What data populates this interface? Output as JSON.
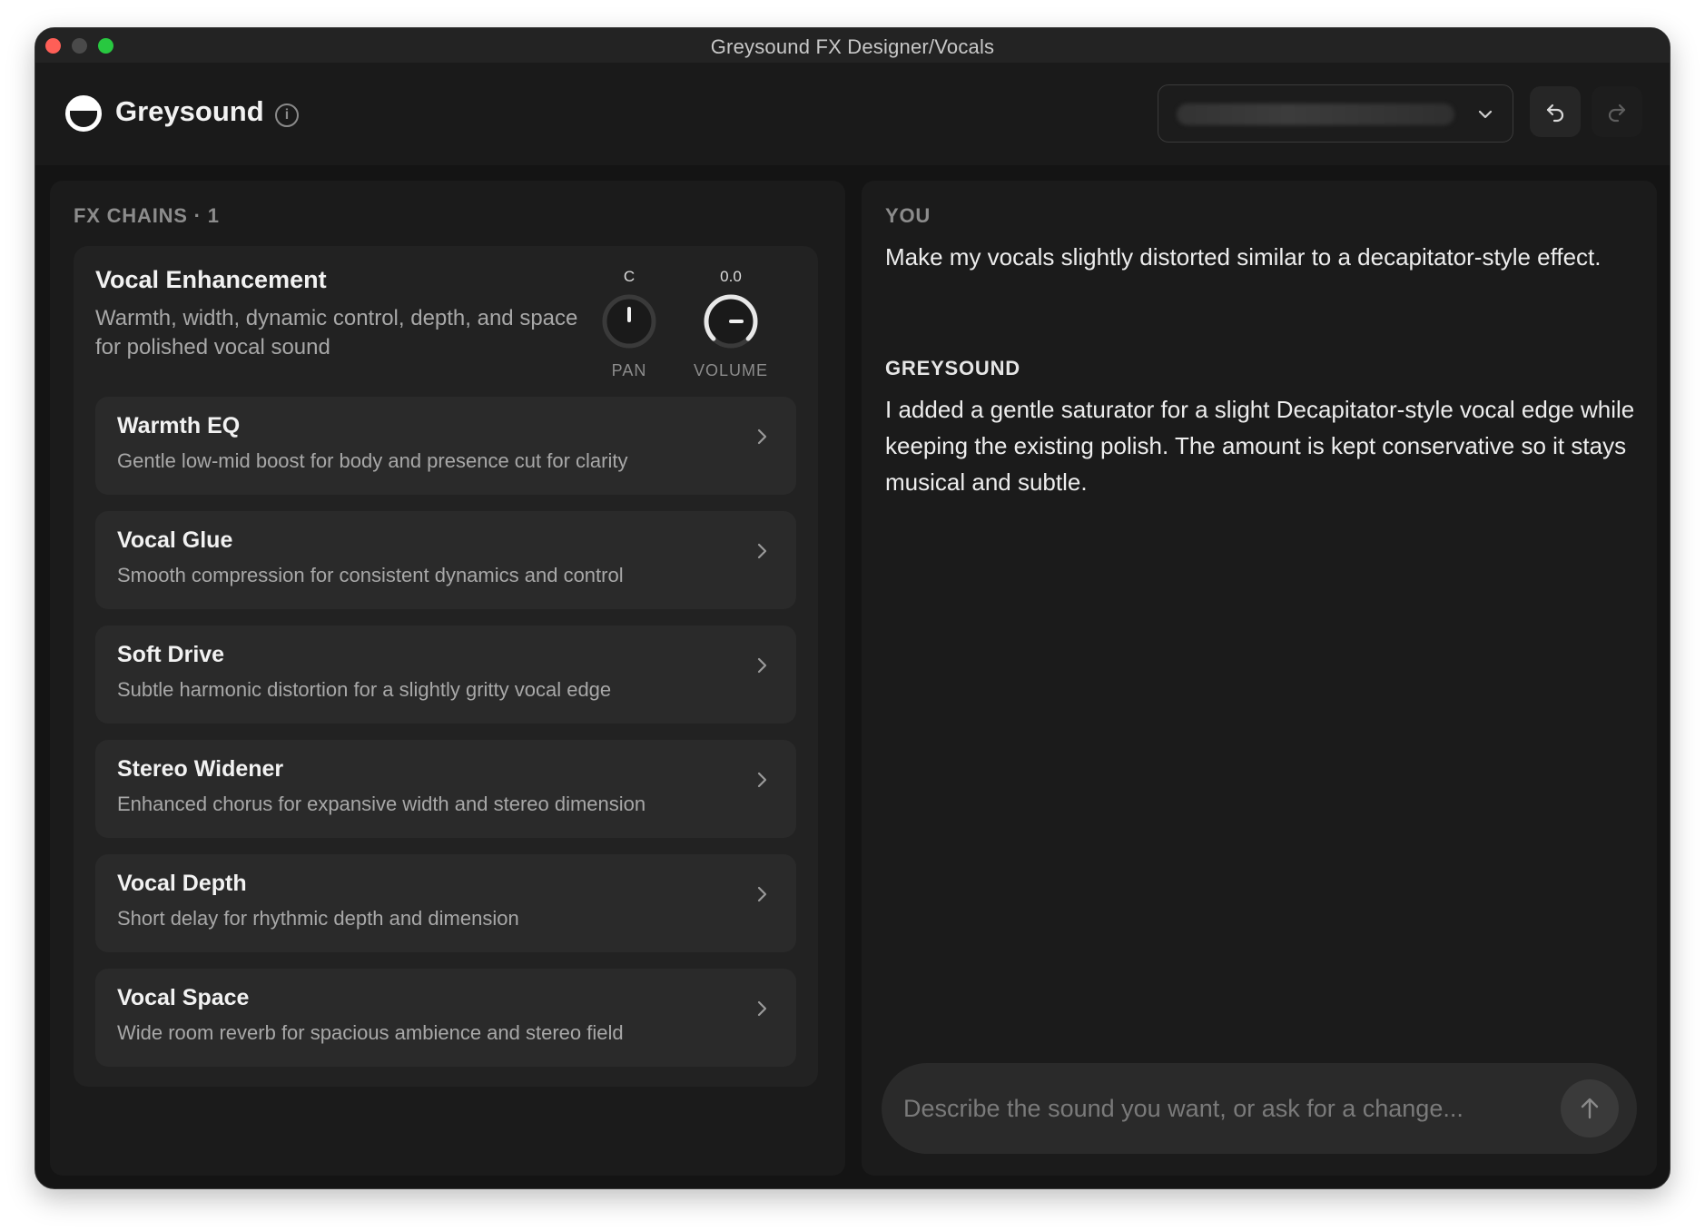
{
  "window": {
    "title": "Greysound FX Designer/Vocals"
  },
  "header": {
    "brand": "Greysound",
    "icons": {
      "logo": "greysound-logo",
      "info": "info-icon",
      "undo": "undo-icon",
      "redo": "redo-icon",
      "chevron": "chevron-down-icon"
    }
  },
  "fx_panel": {
    "section_label": "FX CHAINS · 1",
    "chain": {
      "title": "Vocal Enhancement",
      "description": "Warmth, width, dynamic control, depth, and space for polished vocal sound",
      "pan": {
        "value": "C",
        "label": "PAN"
      },
      "volume": {
        "value": "0.0",
        "label": "VOLUME"
      },
      "items": [
        {
          "name": "Warmth EQ",
          "description": "Gentle low-mid boost for body and presence cut for clarity"
        },
        {
          "name": "Vocal Glue",
          "description": "Smooth compression for consistent dynamics and control"
        },
        {
          "name": "Soft Drive",
          "description": "Subtle harmonic distortion for a slightly gritty vocal edge"
        },
        {
          "name": "Stereo Widener",
          "description": "Enhanced chorus for expansive width and stereo dimension"
        },
        {
          "name": "Vocal Depth",
          "description": "Short delay for rhythmic depth and dimension"
        },
        {
          "name": "Vocal Space",
          "description": "Wide room reverb for spacious ambience and stereo field"
        }
      ]
    }
  },
  "chat": {
    "user_role": "YOU",
    "user_message": "Make my vocals slightly distorted similar to a decapitator-style effect.",
    "assistant_role": "GREYSOUND",
    "assistant_message": "I added a gentle saturator for a slight Decapitator-style vocal edge while keeping the existing polish. The amount is kept conservative so it stays musical and subtle.",
    "composer": {
      "placeholder": "Describe the sound you want, or ask for a change...",
      "value": ""
    }
  },
  "colors": {
    "background": "#141414",
    "panel": "#1b1b1b",
    "card": "#222222",
    "item": "#2a2a2a",
    "text": "#f2f2f2",
    "muted": "#a8a8a8"
  }
}
